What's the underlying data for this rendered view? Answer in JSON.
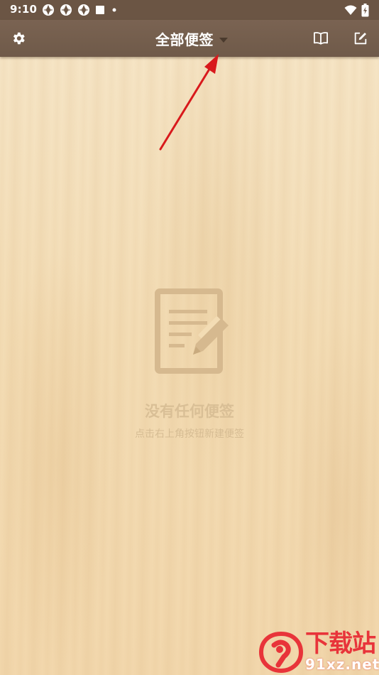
{
  "status_bar": {
    "time": "9:10",
    "icons_left": [
      "app-notification-icon",
      "app-notification-icon",
      "app-notification-icon",
      "square-notification-icon",
      "dot-icon"
    ],
    "icons_right": [
      "wifi-icon",
      "battery-charging-icon"
    ]
  },
  "toolbar": {
    "title": "全部便签",
    "settings_icon": "gear-icon",
    "book_icon": "book-icon",
    "new_note_icon": "edit-icon"
  },
  "empty_state": {
    "icon": "note-edit-icon",
    "title": "没有任何便签",
    "subtitle": "点击右上角按钮新建便签"
  },
  "watermark": {
    "text_cn": "下载站",
    "text_en": "91xz.net"
  },
  "colors": {
    "toolbar": "#6f5a49",
    "status_bar": "#6b5544",
    "background": "#f3dcb4",
    "empty_text": "#d9bf96",
    "annotation_arrow": "#d8191c",
    "watermark_red": "#e8343a"
  }
}
